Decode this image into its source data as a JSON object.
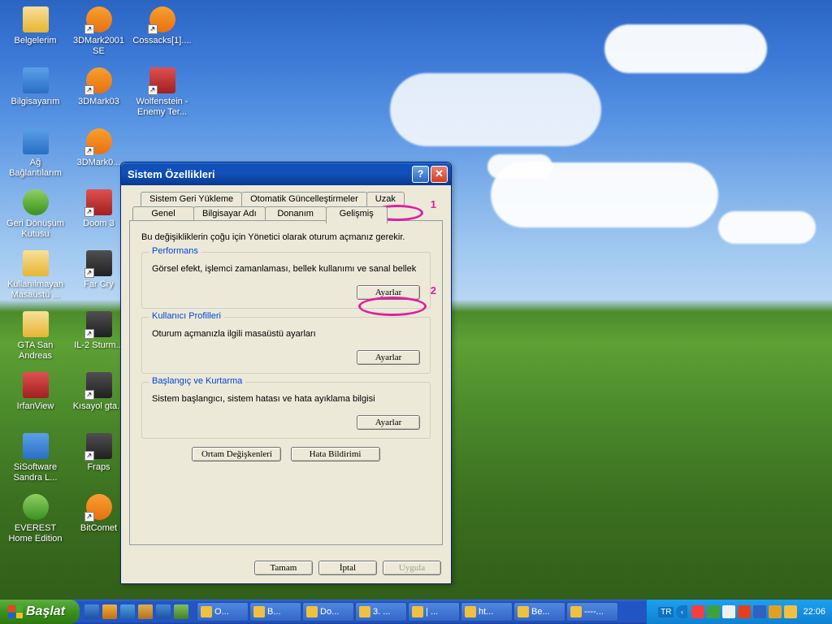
{
  "desktop_icons_cols": [
    [
      {
        "label": "Belgelerim",
        "cls": "folder"
      },
      {
        "label": "Bilgisayarım",
        "cls": "blue"
      },
      {
        "label": "Ağ Bağlantılarım",
        "cls": "blue"
      },
      {
        "label": "Geri Dönüşüm Kutusu",
        "cls": "green"
      },
      {
        "label": "Kullanılmayan Masaüstü ...",
        "cls": "folder"
      },
      {
        "label": "GTA San Andreas",
        "cls": "folder"
      },
      {
        "label": "IrfanView",
        "cls": "red"
      },
      {
        "label": "SiSoftware Sandra L...",
        "cls": "blue"
      },
      {
        "label": "EVEREST Home Edition",
        "cls": "green"
      }
    ],
    [
      {
        "label": "3DMark2001 SE",
        "cls": "orange",
        "shortcut": true
      },
      {
        "label": "3DMark03",
        "cls": "orange",
        "shortcut": true
      },
      {
        "label": "3DMark0...",
        "cls": "orange",
        "shortcut": true
      },
      {
        "label": "Doom 3",
        "cls": "red",
        "shortcut": true
      },
      {
        "label": "Far Cry",
        "cls": "dark",
        "shortcut": true
      },
      {
        "label": "IL-2 Sturm...",
        "cls": "dark",
        "shortcut": true
      },
      {
        "label": "Kısayol gta...",
        "cls": "dark",
        "shortcut": true
      },
      {
        "label": "Fraps",
        "cls": "dark",
        "shortcut": true
      },
      {
        "label": "BitComet",
        "cls": "orange",
        "shortcut": true
      }
    ],
    [
      {
        "label": "Cossacks[1]....",
        "cls": "orange",
        "shortcut": true
      },
      {
        "label": "Wolfenstein - Enemy Ter...",
        "cls": "red",
        "shortcut": true
      }
    ]
  ],
  "dialog": {
    "title": "Sistem Özellikleri",
    "tabs_top": [
      "Sistem Geri Yükleme",
      "Otomatik Güncelleştirmeler",
      "Uzak"
    ],
    "tabs_bottom": [
      "Genel",
      "Bilgisayar Adı",
      "Donanım",
      "Gelişmiş"
    ],
    "active_tab": "Gelişmiş",
    "hint": "Bu değişikliklerin çoğu için Yönetici olarak oturum açmanız gerekir.",
    "perf": {
      "title": "Performans",
      "desc": "Görsel efekt, işlemci zamanlaması, bellek kullanımı ve sanal bellek",
      "btn": "Ayarlar"
    },
    "profiles": {
      "title": "Kullanıcı Profilleri",
      "desc": "Oturum açmanızla ilgili masaüstü ayarları",
      "btn": "Ayarlar"
    },
    "startup": {
      "title": "Başlangıç ve Kurtarma",
      "desc": "Sistem başlangıcı, sistem hatası ve hata ayıklama bilgisi",
      "btn": "Ayarlar"
    },
    "env_btn": "Ortam Değişkenleri",
    "err_btn": "Hata Bildirimi",
    "ok": "Tamam",
    "cancel": "İptal",
    "apply": "Uygula"
  },
  "annotations": {
    "a1": "1",
    "a2": "2"
  },
  "taskbar": {
    "start": "Başlat",
    "tasks": [
      "O...",
      "B...",
      "Do...",
      "3. ...",
      "| ...",
      "ht...",
      "Be...",
      "----..."
    ],
    "lang": "TR",
    "time": "22:06"
  }
}
